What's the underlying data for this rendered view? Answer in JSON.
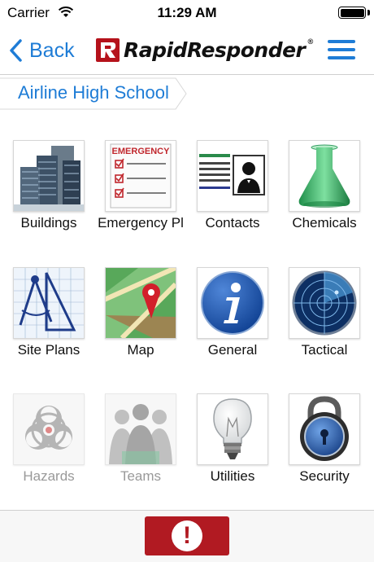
{
  "status_bar": {
    "carrier": "Carrier",
    "time": "11:29 AM"
  },
  "nav": {
    "back_label": "Back",
    "logo_text": "RapidResponder",
    "logo_reg": "®"
  },
  "breadcrumb": {
    "label": "Airline High School"
  },
  "tiles": [
    {
      "label": "Buildings",
      "icon": "buildings-icon",
      "enabled": true
    },
    {
      "label": "Emergency Pl",
      "image_text": "EMERGENCY",
      "icon": "emergency-plan-icon",
      "enabled": true
    },
    {
      "label": "Contacts",
      "icon": "contacts-icon",
      "enabled": true
    },
    {
      "label": "Chemicals",
      "icon": "flask-icon",
      "enabled": true
    },
    {
      "label": "Site Plans",
      "icon": "drafting-tools-icon",
      "enabled": true
    },
    {
      "label": "Map",
      "icon": "map-pin-icon",
      "enabled": true
    },
    {
      "label": "General",
      "icon": "info-icon",
      "enabled": true
    },
    {
      "label": "Tactical",
      "icon": "radar-icon",
      "enabled": true
    },
    {
      "label": "Hazards",
      "icon": "biohazard-icon",
      "enabled": false
    },
    {
      "label": "Teams",
      "icon": "team-people-icon",
      "enabled": false
    },
    {
      "label": "Utilities",
      "icon": "light-bulb-icon",
      "enabled": true
    },
    {
      "label": "Security",
      "icon": "padlock-icon",
      "enabled": true
    }
  ],
  "bottom_bar": {
    "alert_glyph": "!",
    "alert_icon": "exclamation-icon"
  },
  "colors": {
    "accent": "#1e7cd6",
    "alert": "#b11a22",
    "brand": "#b5121b"
  }
}
